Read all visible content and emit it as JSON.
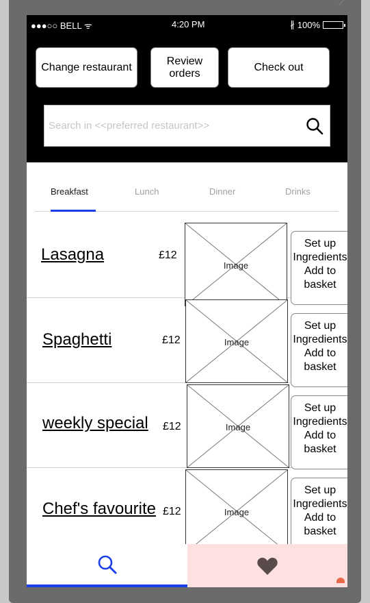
{
  "status": {
    "carrier": "●●●○○ BELL",
    "time": "4:20 PM",
    "battery": "100%"
  },
  "header": {
    "change_restaurant": "Change restaurant",
    "review_orders": "Review orders",
    "check_out": "Check out"
  },
  "search": {
    "placeholder": "Search in <<preferred restaurant>>"
  },
  "tabs": [
    {
      "label": "Breakfast",
      "active": true
    },
    {
      "label": "Lunch",
      "active": false
    },
    {
      "label": "Dinner",
      "active": false
    },
    {
      "label": "Drinks",
      "active": false
    }
  ],
  "menu": {
    "items": [
      {
        "name": "Lasagna",
        "price": "£12",
        "image_label": "Image",
        "action_lines": [
          "Set up",
          "Ingredients",
          "Add to",
          "basket"
        ]
      },
      {
        "name": "Spaghetti",
        "price": "£12",
        "image_label": "Image",
        "action_lines": [
          "Set up",
          "Ingredients",
          "Add to",
          "basket"
        ]
      },
      {
        "name": "weekly special",
        "price": "£12",
        "image_label": "Image",
        "action_lines": [
          "Set up",
          "Ingredients",
          "Add to",
          "basket"
        ]
      },
      {
        "name": "Chef's favourite",
        "price": "£12",
        "image_label": "Image",
        "action_lines": [
          "Set up",
          "Ingredients",
          "Add to",
          "basket"
        ]
      }
    ]
  },
  "bottom_nav": {
    "icons": [
      "search-icon",
      "heart-icon"
    ]
  },
  "colors": {
    "accent": "#1a3fe6",
    "favorites_bg": "#fde0e0",
    "header_bg": "#000000"
  }
}
